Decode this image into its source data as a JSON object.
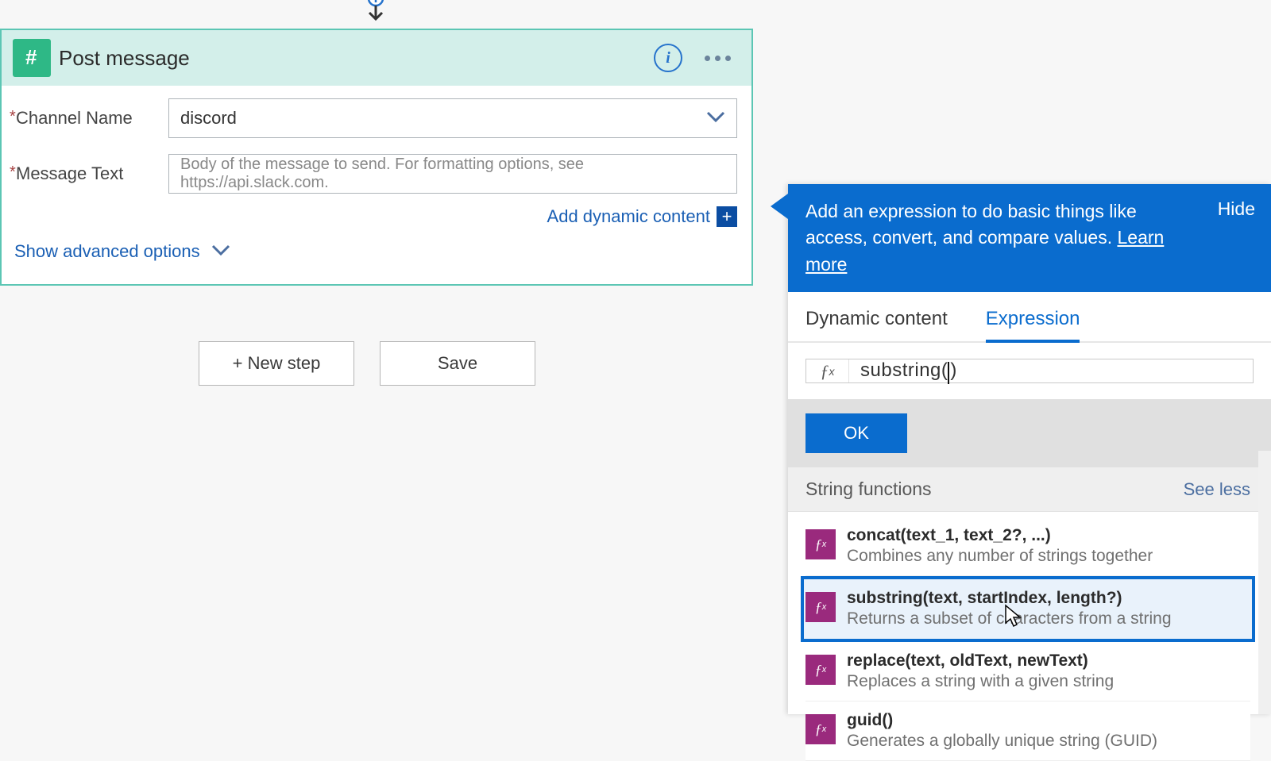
{
  "card": {
    "title": "Post message",
    "connector_icon": "slack-icon",
    "fields": {
      "channel": {
        "label": "Channel Name",
        "value": "discord"
      },
      "message": {
        "label": "Message Text",
        "placeholder": "Body of the message to send. For formatting options, see https://api.slack.com."
      }
    },
    "add_dynamic_content": "Add dynamic content",
    "show_advanced": "Show advanced options"
  },
  "footer": {
    "new_step": "+ New step",
    "save": "Save"
  },
  "panel": {
    "banner_text": "Add an expression to do basic things like access, convert, and compare values.",
    "learn_more": "Learn more",
    "hide": "Hide",
    "tabs": {
      "dynamic": "Dynamic content",
      "expression": "Expression"
    },
    "active_tab": "expression",
    "expression_value_pre": "substring(",
    "expression_value_post": ")",
    "ok": "OK",
    "group_title": "String functions",
    "see_less": "See less",
    "functions": [
      {
        "sig": "concat(text_1, text_2?, ...)",
        "desc": "Combines any number of strings together",
        "selected": false
      },
      {
        "sig": "substring(text, startIndex, length?)",
        "desc": "Returns a subset of characters from a string",
        "selected": true
      },
      {
        "sig": "replace(text, oldText, newText)",
        "desc": "Replaces a string with a given string",
        "selected": false
      },
      {
        "sig": "guid()",
        "desc": "Generates a globally unique string (GUID)",
        "selected": false
      }
    ]
  },
  "colors": {
    "accent": "#0a6cce",
    "connector": "#2eb886",
    "fx": "#9a2a7d"
  }
}
